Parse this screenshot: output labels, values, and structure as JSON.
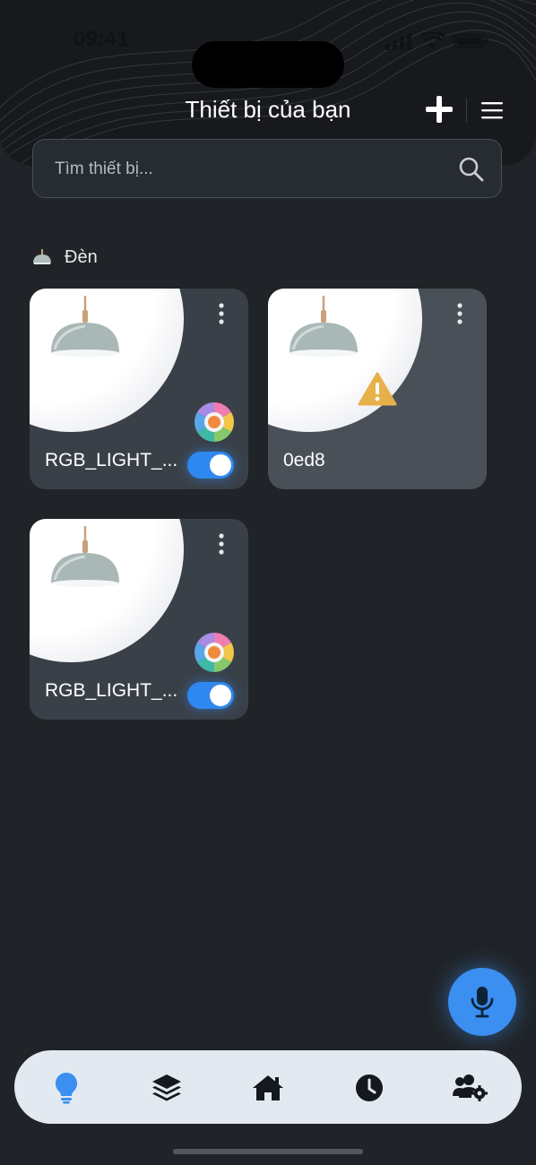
{
  "status": {
    "time": "09:41"
  },
  "header": {
    "title": "Thiết bị của bạn",
    "add_icon": "plus-icon",
    "menu_icon": "hamburger-menu-icon"
  },
  "search": {
    "placeholder": "Tìm thiết bị...",
    "value": "",
    "icon": "search-icon"
  },
  "section": {
    "title": "Đèn",
    "icon": "lamp-icon"
  },
  "devices": [
    {
      "name": "RGB_LIGHT_...",
      "online": true,
      "power_on": true,
      "has_color": true
    },
    {
      "name": "0ed8",
      "online": false,
      "power_on": false,
      "has_color": false,
      "status_icon": "warning-icon"
    },
    {
      "name": "RGB_LIGHT_...",
      "online": true,
      "power_on": true,
      "has_color": true
    }
  ],
  "mic_button": {
    "icon": "microphone-icon"
  },
  "tabbar": {
    "active_index": 0,
    "tabs": [
      {
        "icon": "lightbulb-icon"
      },
      {
        "icon": "layers-icon"
      },
      {
        "icon": "home-icon"
      },
      {
        "icon": "clock-icon"
      },
      {
        "icon": "users-settings-icon"
      }
    ]
  },
  "colors": {
    "background": "#202428",
    "accent": "#2f88f0",
    "card": "#3a4048",
    "tabbar": "#e3e9f1",
    "warning": "#e8b04a"
  }
}
